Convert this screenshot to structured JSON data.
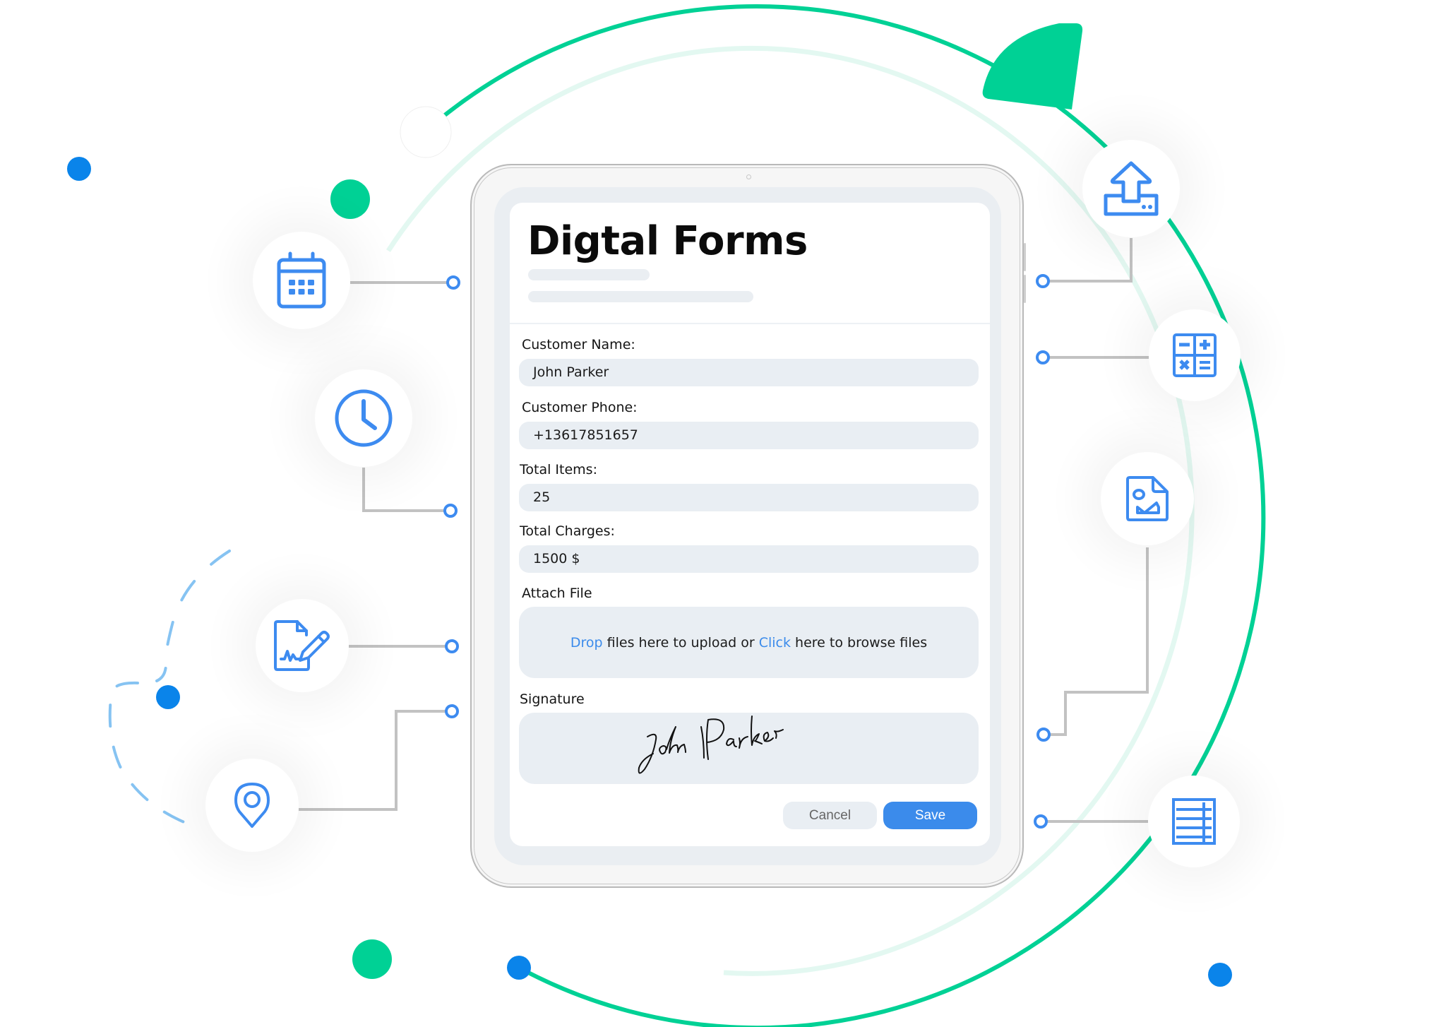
{
  "colors": {
    "accent_green": "#00d195",
    "light_green": "#e3f8f1",
    "accent_blue": "#3b8beb",
    "dot_blue": "#0a84ea",
    "connector_gray": "#c2c2c2",
    "dashed_blue": "#86c3f2"
  },
  "form": {
    "title": "Digtal Forms",
    "fields": [
      {
        "label": "Customer Name:",
        "value": "John Parker"
      },
      {
        "label": "Customer Phone:",
        "value": "+13617851657"
      },
      {
        "label": "Total Items:",
        "value": "25"
      },
      {
        "label": "Total Charges:",
        "value": "1500 $"
      }
    ],
    "attach": {
      "label": "Attach File",
      "drop_link": "Drop",
      "drop_text": " files here to upload or ",
      "click_link": "Click",
      "click_text": " here to browse files"
    },
    "signature": {
      "label": "Signature",
      "signed_name": "John Parker"
    },
    "buttons": {
      "cancel": "Cancel",
      "save": "Save"
    }
  },
  "feature_icons": {
    "left": [
      "calendar-icon",
      "clock-icon",
      "signature-document-icon",
      "location-pin-icon"
    ],
    "right": [
      "upload-icon",
      "calculator-icon",
      "image-file-icon",
      "table-icon"
    ]
  }
}
